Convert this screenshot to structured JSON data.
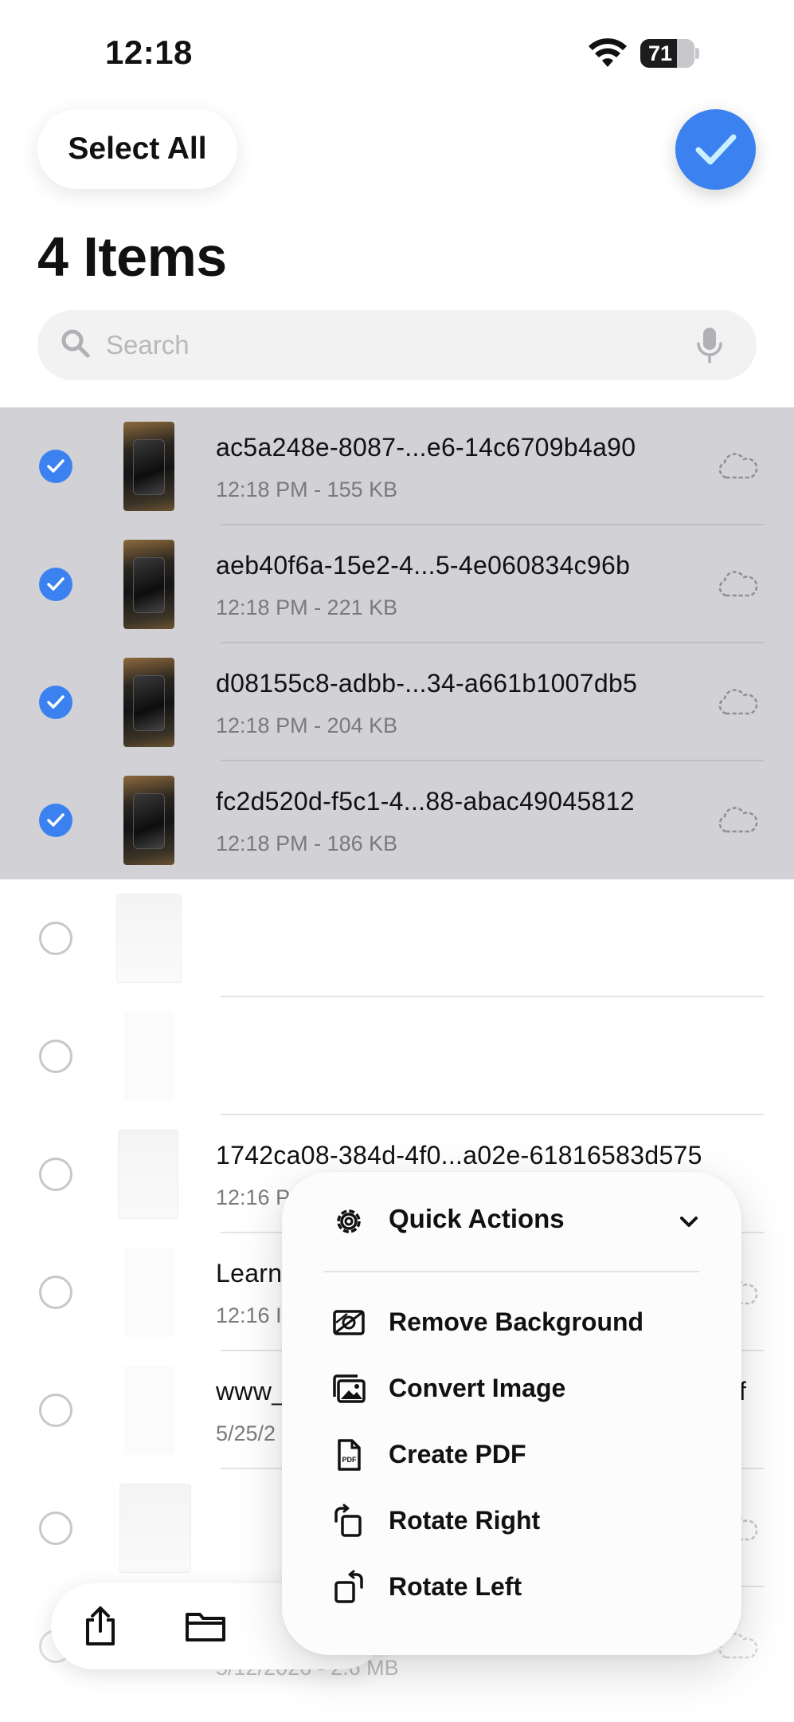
{
  "status_bar": {
    "time": "12:18",
    "battery": "71"
  },
  "header": {
    "select_all_label": "Select All",
    "title": "4 Items"
  },
  "search": {
    "placeholder": "Search"
  },
  "files": [
    {
      "name": "ac5a248e-8087-...e6-14c6709b4a90",
      "meta": "12:18 PM - 155 KB",
      "selected": true
    },
    {
      "name": "aeb40f6a-15e2-4...5-4e060834c96b",
      "meta": "12:18 PM - 221 KB",
      "selected": true
    },
    {
      "name": "d08155c8-adbb-...34-a661b1007db5",
      "meta": "12:18 PM - 204 KB",
      "selected": true
    },
    {
      "name": "fc2d520d-f5c1-4...88-abac49045812",
      "meta": "12:18 PM - 186 KB",
      "selected": true
    },
    {
      "name": "",
      "meta": "",
      "selected": false
    },
    {
      "name": "",
      "meta": "",
      "selected": false
    },
    {
      "name": "1742ca08-384d-4f0...a02e-61816583d575",
      "meta": "12:16 P",
      "selected": false
    },
    {
      "name": "Learn",
      "meta": "12:16 I",
      "selected": false
    },
    {
      "name": "www_",
      "meta": "5/25/2",
      "trailing": "f",
      "selected": false
    },
    {
      "name": "",
      "meta": "",
      "selected": false
    },
    {
      "name": "",
      "meta": "5/12/2026 - 2.6 MB",
      "selected": false
    }
  ],
  "quick_actions": {
    "title": "Quick Actions",
    "items": [
      {
        "label": "Remove Background",
        "icon": "remove-background-icon"
      },
      {
        "label": "Convert Image",
        "icon": "convert-image-icon"
      },
      {
        "label": "Create PDF",
        "icon": "pdf-file-icon"
      },
      {
        "label": "Rotate Right",
        "icon": "rotate-right-icon"
      },
      {
        "label": "Rotate Left",
        "icon": "rotate-left-icon"
      }
    ]
  },
  "colors": {
    "accent": "#3b82f0",
    "selected_row": "#d1d1d6"
  }
}
